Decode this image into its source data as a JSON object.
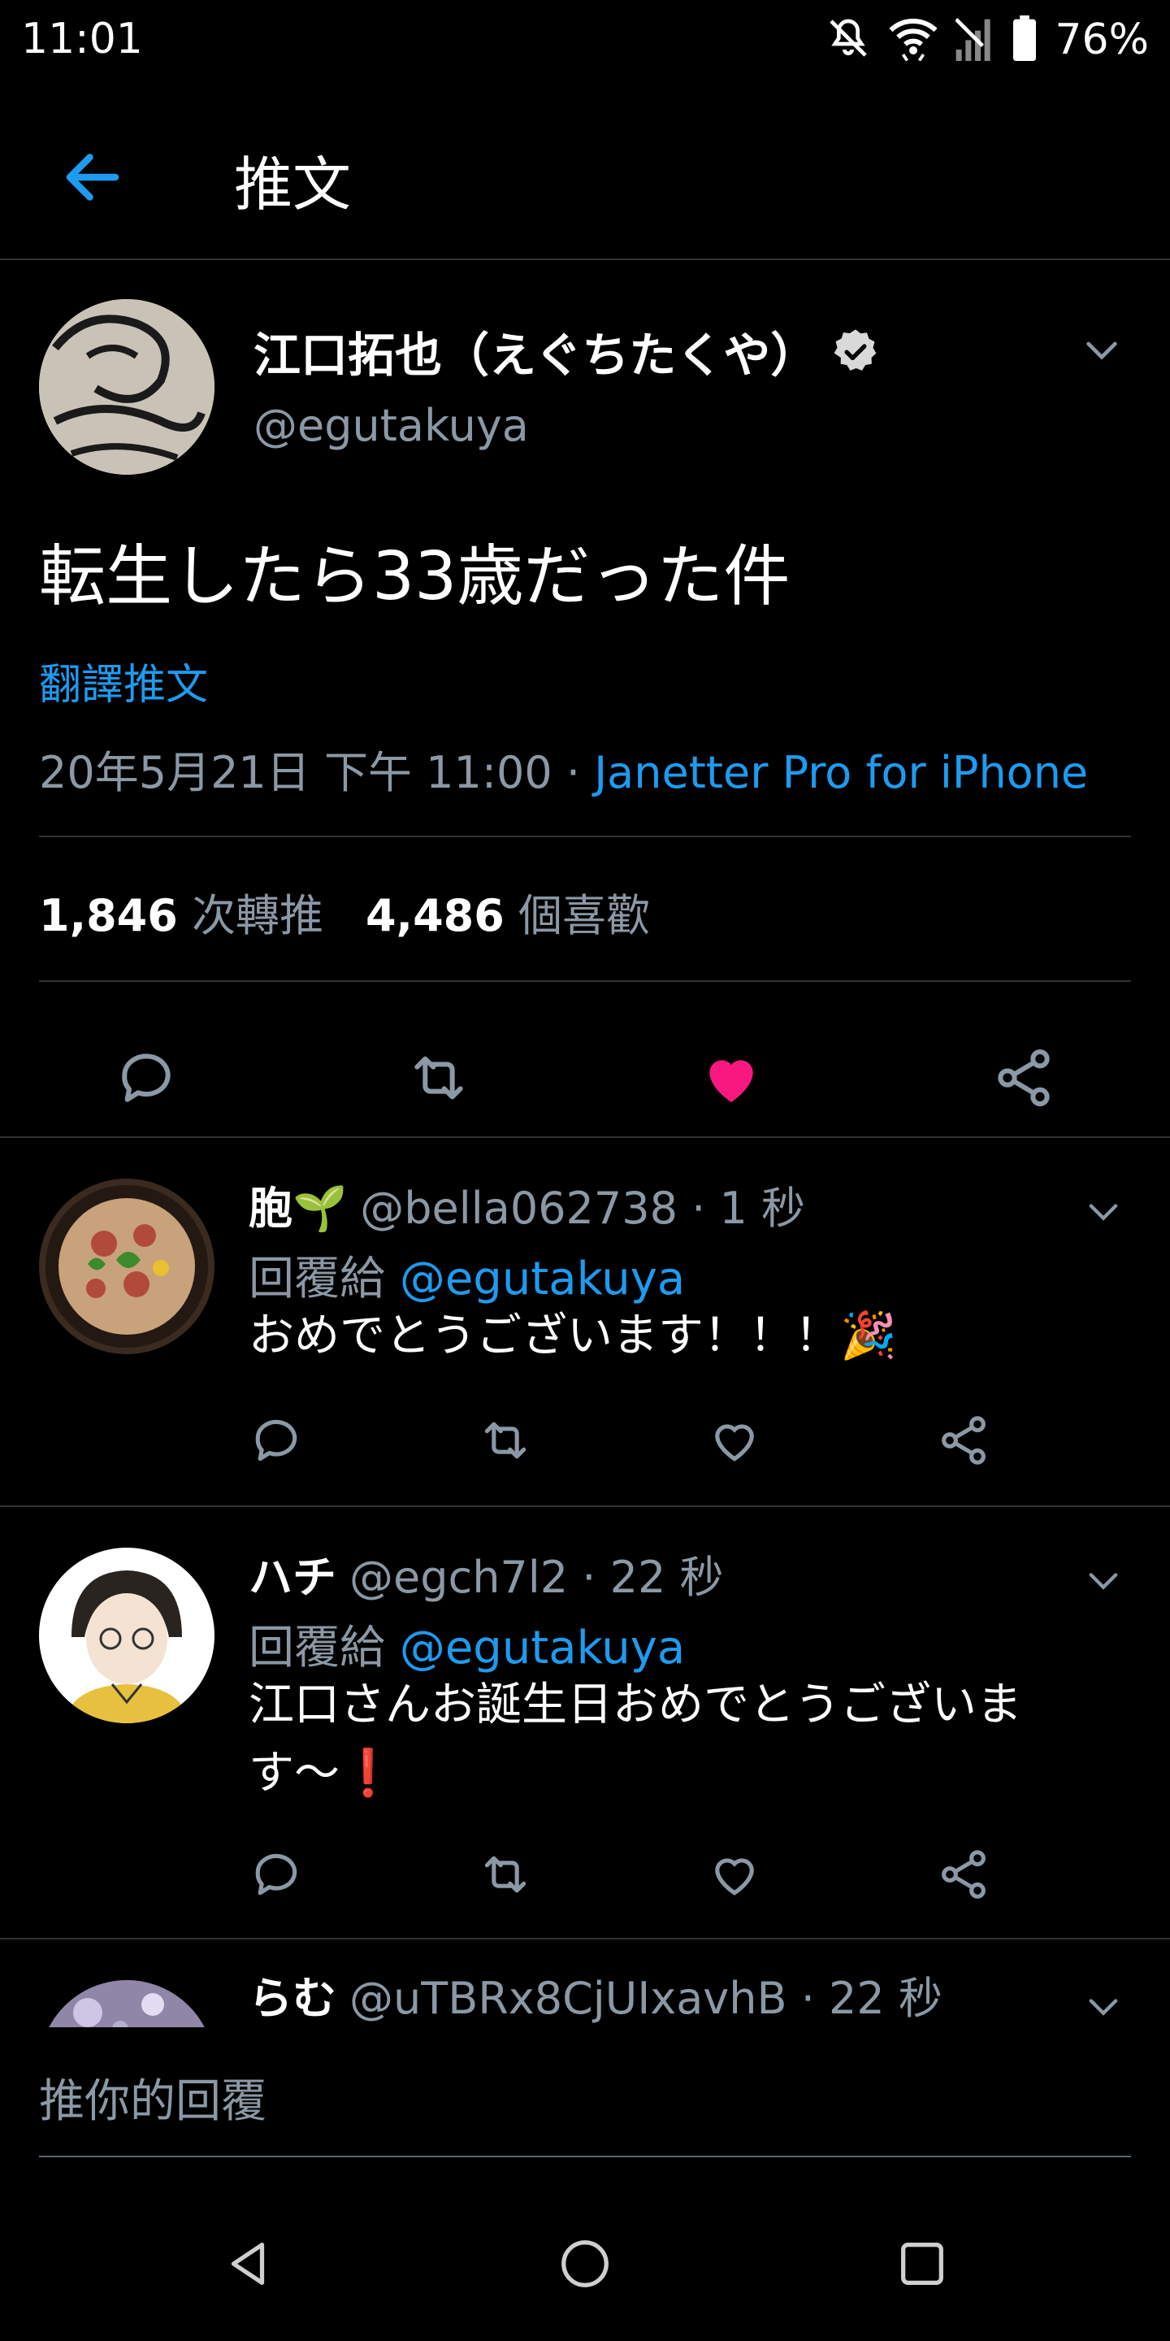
{
  "status_bar": {
    "time": "11:01",
    "battery": "76%"
  },
  "header": {
    "title": "推文"
  },
  "tweet": {
    "display_name": "江口拓也（えぐちたくや）",
    "handle": "@egutakuya",
    "text": "転生したら33歳だった件",
    "translate_label": "翻譯推文",
    "timestamp": "20年5月21日 下午 11:00 · ",
    "source": "Janetter Pro for iPhone",
    "retweet_count": "1,846",
    "retweet_label": "次轉推",
    "like_count": "4,486",
    "like_label": "個喜歡",
    "liked": true
  },
  "replies": [
    {
      "name": "胞🌱",
      "handle": "@bella062738",
      "time": " · 1 秒",
      "reply_to_label": "回覆給",
      "reply_to_handle": "@egutakuya",
      "text": "おめでとうございます！！！🎉"
    },
    {
      "name": "ハチ",
      "handle": "@egch7l2",
      "time": " · 22 秒",
      "reply_to_label": "回覆給",
      "reply_to_handle": "@egutakuya",
      "text": "江口さんお誕生日おめでとうございます〜❗"
    },
    {
      "name": "らむ",
      "handle": "@uTBRx8CjUIxavhB",
      "time": " · 22 秒"
    }
  ],
  "composer": {
    "placeholder": "推你的回覆"
  },
  "colors": {
    "background": "#000000",
    "accent": "#1d9bf0",
    "like": "#f91880",
    "muted": "#8b98a5"
  }
}
